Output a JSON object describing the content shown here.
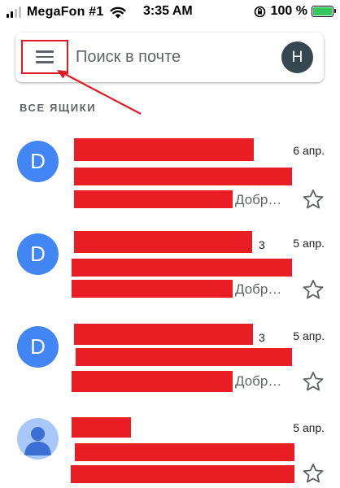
{
  "status_bar": {
    "carrier": "MegaFon #1",
    "time": "3:35 AM",
    "battery_percent": "100 %",
    "battery_level": 1.0,
    "battery_color": "#34c759"
  },
  "search": {
    "placeholder": "Поиск в почте",
    "account_initial": "H",
    "menu_icon": "hamburger-menu-icon"
  },
  "section_title": "ВСЕ ЯЩИКИ",
  "colors": {
    "annotation_red": "#e01b24",
    "avatar_blue": "#4285f4"
  },
  "emails": [
    {
      "avatar": "D",
      "date": "6 апр.",
      "count": "",
      "snippet": "Добр…",
      "starred": false
    },
    {
      "avatar": "D",
      "date": "5 апр.",
      "count": "3",
      "snippet": "Добр…",
      "starred": false
    },
    {
      "avatar": "D",
      "date": "5 апр.",
      "count": "3",
      "snippet": "Добр…",
      "starred": false
    },
    {
      "avatar": "",
      "date": "5 апр.",
      "count": "",
      "snippet": "",
      "starred": false
    }
  ]
}
